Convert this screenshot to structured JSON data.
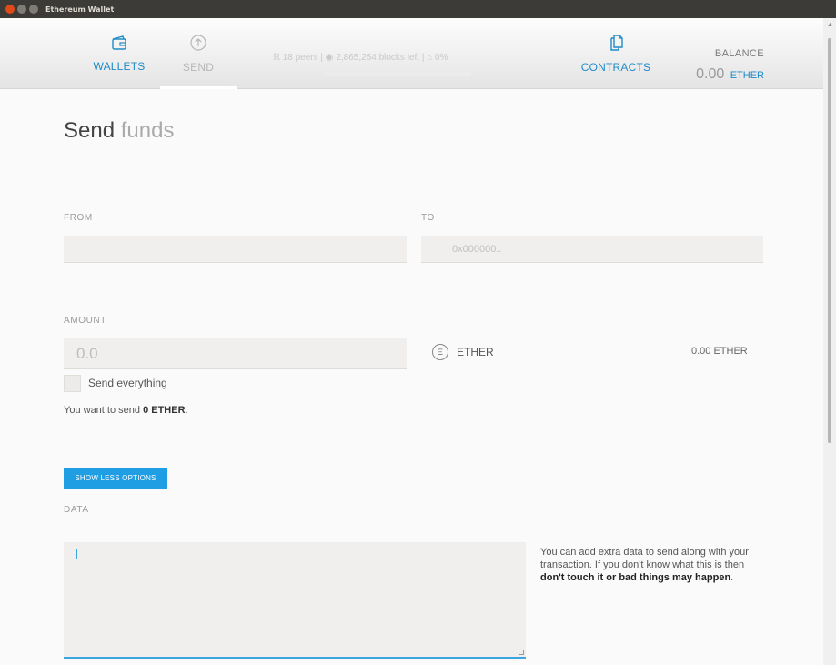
{
  "window": {
    "title": "Ethereum Wallet"
  },
  "header": {
    "nav": {
      "wallets": "WALLETS",
      "send": "SEND",
      "contracts": "CONTRACTS"
    },
    "node_info": {
      "peers": "18 peers",
      "blocks": "2,865,254 blocks left",
      "mining": "0%"
    },
    "sync_progress": 0,
    "balance": {
      "label": "BALANCE",
      "value": "0.00",
      "unit": "ETHER"
    }
  },
  "page": {
    "title_strong": "Send",
    "title_light": "funds"
  },
  "form": {
    "from_label": "FROM",
    "from_value": "",
    "to_label": "TO",
    "to_placeholder": "0x000000..",
    "amount_label": "AMOUNT",
    "amount_placeholder": "0.0",
    "currency": "ETHER",
    "amount_balance": "0.00 ETHER",
    "send_everything_label": "Send everything",
    "summary_prefix": "You want to send",
    "summary_amount": "0 ETHER",
    "summary_suffix": ".",
    "options_button": "SHOW LESS OPTIONS",
    "data_label": "DATA",
    "data_hint_text": "You can add extra data to send along with your transaction. If you don't know what this is then",
    "data_hint_warning": "don't touch it or bad things may happen",
    "data_hint_end": "."
  },
  "colors": {
    "accent": "#1f8bc7",
    "button": "#1f9ee4",
    "titlebar": "#3c3b37",
    "close_button": "#df4a16"
  },
  "icons": {
    "wallets": "wallet-icon",
    "send": "arrow-up-circle-icon",
    "contracts": "contracts-icon",
    "peers": "peers-icon",
    "blocks": "blocks-icon",
    "mining": "mining-icon",
    "currency": "ether-icon"
  }
}
